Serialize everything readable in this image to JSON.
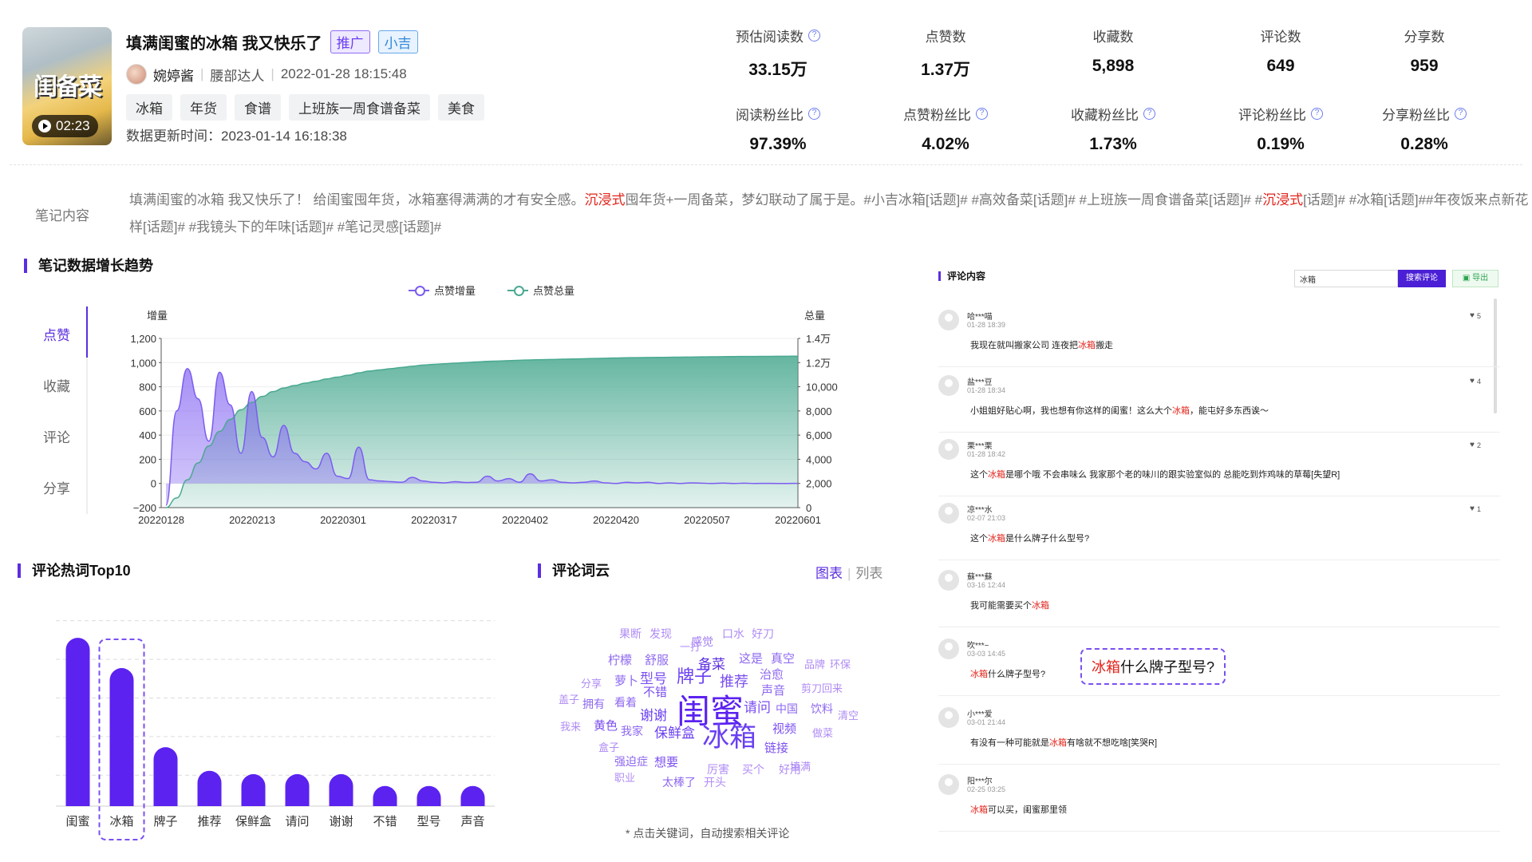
{
  "note": {
    "title": "填满闺蜜的冰箱 我又快乐了",
    "badges": {
      "promo": "推广",
      "brand": "小吉"
    },
    "thumb_text": "闺备菜",
    "duration": "02:23",
    "author": "婉婷酱",
    "author_level": "腰部达人",
    "published": "2022-01-28 18:15:48",
    "tags": [
      "冰箱",
      "年货",
      "食谱",
      "上班族一周食谱备菜",
      "美食"
    ],
    "updated": "数据更新时间：2023-01-14 16:18:38",
    "content_label": "笔记内容",
    "content_parts": [
      {
        "t": "填满闺蜜的冰箱 我又快乐了！ 给闺蜜囤年货，冰箱塞得满满的才有安全感。",
        "hl": false
      },
      {
        "t": "沉浸式",
        "hl": true
      },
      {
        "t": "囤年货+一周备菜，梦幻联动了属于是。#小吉冰箱[话题]# #高效备菜[话题]# #上班族一周食谱备菜[话题]# #",
        "hl": false
      },
      {
        "t": "沉浸式",
        "hl": true
      },
      {
        "t": "[话题]# #冰箱[话题]##年夜饭来点新花样[话题]# #我镜头下的年味[话题]# #笔记灵感[话题]#",
        "hl": false
      }
    ]
  },
  "metrics": {
    "row1": [
      {
        "label": "预估阅读数",
        "value": "33.15万",
        "help": true
      },
      {
        "label": "点赞数",
        "value": "1.37万",
        "help": false
      },
      {
        "label": "收藏数",
        "value": "5,898",
        "help": false
      },
      {
        "label": "评论数",
        "value": "649",
        "help": false
      },
      {
        "label": "分享数",
        "value": "959",
        "help": false
      }
    ],
    "row2": [
      {
        "label": "阅读粉丝比",
        "value": "97.39%",
        "help": true
      },
      {
        "label": "点赞粉丝比",
        "value": "4.02%",
        "help": true
      },
      {
        "label": "收藏粉丝比",
        "value": "1.73%",
        "help": true
      },
      {
        "label": "评论粉丝比",
        "value": "0.19%",
        "help": true
      },
      {
        "label": "分享粉丝比",
        "value": "0.28%",
        "help": true
      }
    ]
  },
  "trend": {
    "title": "笔记数据增长趋势",
    "tabs": [
      "点赞",
      "收藏",
      "评论",
      "分享"
    ],
    "active_tab": "点赞",
    "colors": {
      "increment": "#7b5cf0",
      "total": "#4aa991"
    }
  },
  "chart_data": [
    {
      "type": "area",
      "title": "",
      "legend": [
        "点赞增量",
        "点赞总量"
      ],
      "legend_position": "top",
      "ylabel": "增量",
      "y2label": "总量",
      "ylim": [
        -200,
        1200
      ],
      "y2lim": [
        0,
        14000
      ],
      "yticks": [
        "1,200",
        "1,000",
        "800",
        "600",
        "400",
        "200",
        "0",
        "−200"
      ],
      "y2ticks": [
        "1.4万",
        "1.2万",
        "10,000",
        "8,000",
        "6,000",
        "4,000",
        "2,000",
        "0"
      ],
      "xticks": [
        "20220128",
        "20220213",
        "20220301",
        "20220317",
        "20220402",
        "20220420",
        "20220507",
        "20220601"
      ],
      "series": [
        {
          "name": "点赞增量",
          "axis": "left",
          "values": [
            -180,
            600,
            950,
            700,
            350,
            920,
            650,
            250,
            760,
            380,
            220,
            480,
            250,
            180,
            120,
            250,
            60,
            40,
            300,
            30,
            20,
            15,
            10,
            50,
            20,
            10,
            5,
            15,
            8,
            10,
            60,
            20,
            40,
            10,
            80,
            20,
            30,
            10,
            5,
            10,
            20,
            5,
            0,
            10,
            5,
            10,
            0,
            5,
            0,
            5,
            2,
            0,
            3,
            0,
            2,
            0,
            1,
            0,
            0,
            1
          ]
        },
        {
          "name": "点赞总量",
          "axis": "right",
          "values": [
            0,
            800,
            2300,
            3700,
            5100,
            6300,
            7300,
            8100,
            8700,
            9200,
            9600,
            9900,
            10100,
            10300,
            10450,
            10650,
            10800,
            10950,
            11150,
            11300,
            11400,
            11500,
            11600,
            11700,
            11800,
            11850,
            11900,
            11950,
            12000,
            12050,
            12100,
            12130,
            12160,
            12190,
            12220,
            12240,
            12260,
            12280,
            12300,
            12320,
            12340,
            12360,
            12380,
            12400,
            12410,
            12420,
            12430,
            12440,
            12450,
            12460,
            12470,
            12480,
            12490,
            12500,
            12505,
            12510,
            12515,
            12520,
            12525,
            12530
          ]
        }
      ]
    },
    {
      "type": "bar",
      "title": "评论热词Top10",
      "categories": [
        "闺蜜",
        "冰箱",
        "牌子",
        "推荐",
        "保鲜盒",
        "请问",
        "谢谢",
        "不错",
        "型号",
        "声音"
      ],
      "values": [
        100,
        82,
        35,
        21,
        19,
        19,
        19,
        12,
        12,
        12
      ],
      "highlight": "冰箱",
      "color": "#5b22f0"
    }
  ],
  "wordcloud": {
    "title": "评论词云",
    "tab_chart": "图表",
    "tab_list": "列表",
    "hint": "* 点击关键词，自动搜索相关评论",
    "words": [
      "果断",
      "发现",
      "感觉",
      "口水",
      "好刀",
      "一打",
      "柠檬",
      "舒服",
      "备菜",
      "这是",
      "真空",
      "品牌",
      "环保",
      "分享",
      "萝卜",
      "型号",
      "牌子",
      "推荐",
      "治愈",
      "不错",
      "声音",
      "剪刀",
      "回来",
      "盖子",
      "拥有",
      "看着",
      "谢谢",
      "闺蜜",
      "请问",
      "中国",
      "饮料",
      "清空",
      "我来",
      "黄色",
      "我家",
      "保鲜盒",
      "冰箱",
      "视频",
      "做菜",
      "盒子",
      "链接",
      "强迫症",
      "想要",
      "填满",
      "厉害",
      "买个",
      "好用",
      "职业",
      "太棒了",
      "开头"
    ]
  },
  "comments": {
    "title": "评论内容",
    "search_value": "冰箱",
    "search_button": "搜索评论",
    "export_button": "导出",
    "callout": {
      "hl": "冰箱",
      "rest": "什么牌子型号?"
    },
    "items": [
      {
        "name": "哈***喵",
        "time": "01-28 18:39",
        "likes": "5",
        "parts": [
          {
            "t": "我现在就叫搬家公司 连夜把",
            "hl": false
          },
          {
            "t": "冰箱",
            "hl": true
          },
          {
            "t": "搬走",
            "hl": false
          }
        ]
      },
      {
        "name": "盐***豆",
        "time": "01-28 18:34",
        "likes": "4",
        "parts": [
          {
            "t": "小姐姐好贴心啊，我也想有你这样的闺蜜！这么大个",
            "hl": false
          },
          {
            "t": "冰箱",
            "hl": true
          },
          {
            "t": "，能屯好多东西诶～",
            "hl": false
          }
        ]
      },
      {
        "name": "栗***栗",
        "time": "01-28 18:42",
        "likes": "2",
        "parts": [
          {
            "t": "这个",
            "hl": false
          },
          {
            "t": "冰箱",
            "hl": true
          },
          {
            "t": "是哪个哦 不会串味么 我家那个老的味川的跟实验室似的 总能吃到炸鸡味的草莓[失望R]",
            "hl": false
          }
        ]
      },
      {
        "name": "凉***水",
        "time": "02-07 21:03",
        "likes": "1",
        "parts": [
          {
            "t": "这个",
            "hl": false
          },
          {
            "t": "冰箱",
            "hl": true
          },
          {
            "t": "是什么牌子什么型号?",
            "hl": false
          }
        ]
      },
      {
        "name": "蘇***蘇",
        "time": "03-16 12:44",
        "likes": "",
        "parts": [
          {
            "t": "我可能需要买个",
            "hl": false
          },
          {
            "t": "冰箱",
            "hl": true
          }
        ]
      },
      {
        "name": "吹***~",
        "time": "03-03 14:45",
        "likes": "",
        "parts": [
          {
            "t": "冰箱",
            "hl": true
          },
          {
            "t": "什么牌子型号?",
            "hl": false
          }
        ]
      },
      {
        "name": "小***爱",
        "time": "03-01 21:44",
        "likes": "",
        "parts": [
          {
            "t": "有没有一种可能就是",
            "hl": false
          },
          {
            "t": "冰箱",
            "hl": true
          },
          {
            "t": "有啥就不想吃啥[笑哭R]",
            "hl": false
          }
        ]
      },
      {
        "name": "阳***尔",
        "time": "02-25 03:25",
        "likes": "",
        "parts": [
          {
            "t": "冰箱",
            "hl": true
          },
          {
            "t": "可以买，闺蜜那里领",
            "hl": false
          }
        ]
      }
    ]
  }
}
